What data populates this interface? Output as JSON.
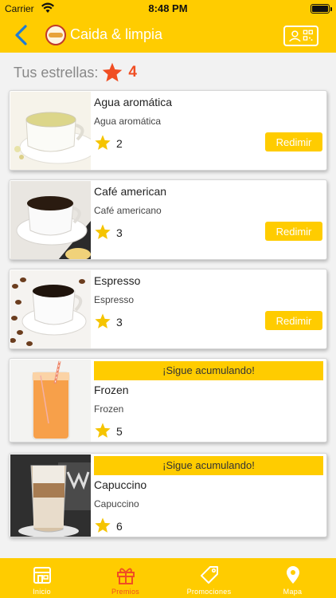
{
  "status_bar": {
    "carrier": "Carrier",
    "time": "8:48 PM"
  },
  "nav": {
    "title": "Caida & limpia",
    "back_icon": "chevron-left-icon",
    "qr_icon": "profile-qr-icon"
  },
  "stars_summary": {
    "label": "Tus estrellas:",
    "count": "4"
  },
  "products": [
    {
      "name": "Agua aromática",
      "description": "Agua aromática",
      "stars": "2",
      "action": "Redimir"
    },
    {
      "name": "Café american",
      "description": "Café americano",
      "stars": "3",
      "action": "Redimir"
    },
    {
      "name": "Espresso",
      "description": "Espresso",
      "stars": "3",
      "action": "Redimir"
    },
    {
      "name": "Frozen",
      "description": "Frozen",
      "stars": "5",
      "banner": "¡Sigue acumulando!"
    },
    {
      "name": "Capuccino",
      "description": "Capuccino",
      "stars": "6",
      "banner": "¡Sigue acumulando!"
    }
  ],
  "tabs": [
    {
      "label": "Inicio",
      "icon": "store-icon"
    },
    {
      "label": "Premios",
      "icon": "gift-icon",
      "active": true
    },
    {
      "label": "Promociones",
      "icon": "tag-icon"
    },
    {
      "label": "Mapa",
      "icon": "map-pin-icon"
    }
  ],
  "colors": {
    "primary": "#ffcc00",
    "accent": "#f04e23",
    "background": "#f2f2f2"
  }
}
